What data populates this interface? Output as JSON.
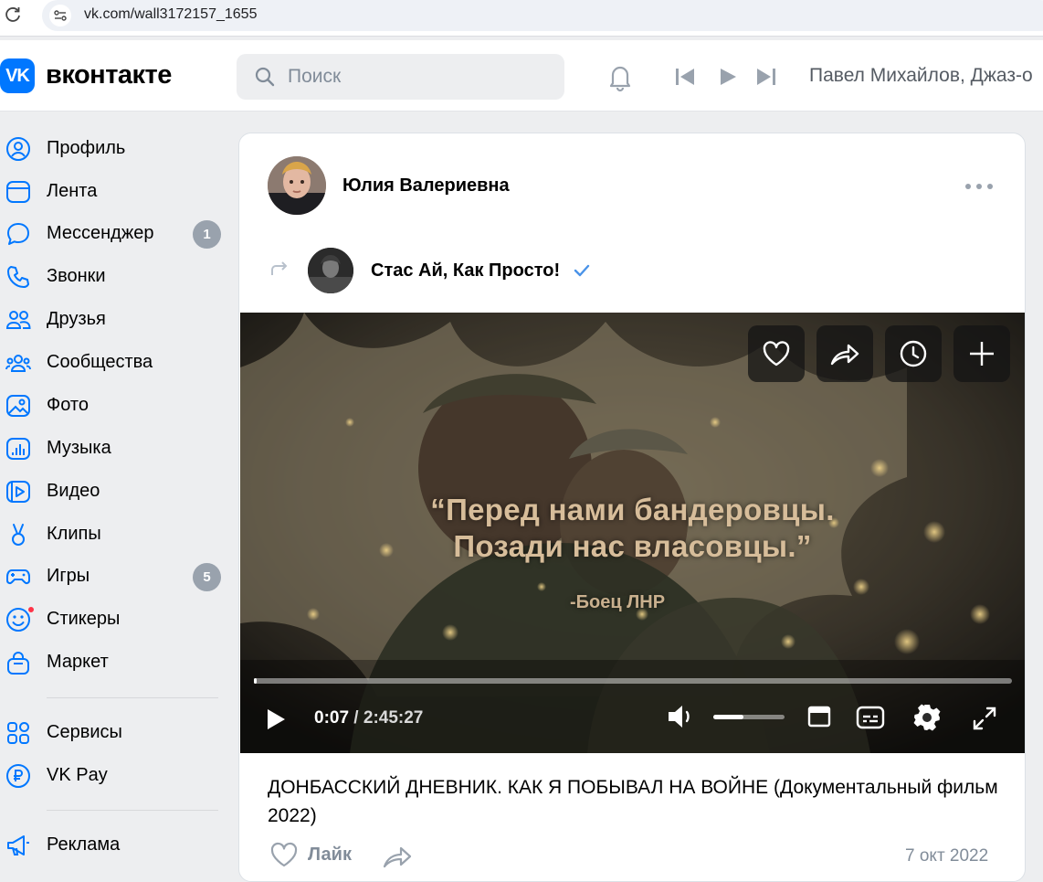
{
  "browser": {
    "url": "vk.com/wall3172157_1655"
  },
  "header": {
    "logo_icon_text": "VK",
    "logo_text": "вконтакте",
    "search_placeholder": "Поиск",
    "now_playing": "Павел Михайлов, Джаз-о"
  },
  "sidebar": {
    "items": [
      {
        "label": "Профиль",
        "icon": "profile-icon"
      },
      {
        "label": "Лента",
        "icon": "feed-icon"
      },
      {
        "label": "Мессенджер",
        "icon": "messenger-icon",
        "badge": "1"
      },
      {
        "label": "Звонки",
        "icon": "calls-icon"
      },
      {
        "label": "Друзья",
        "icon": "friends-icon"
      },
      {
        "label": "Сообщества",
        "icon": "communities-icon"
      },
      {
        "label": "Фото",
        "icon": "photo-icon"
      },
      {
        "label": "Музыка",
        "icon": "music-icon"
      },
      {
        "label": "Видео",
        "icon": "video-icon"
      },
      {
        "label": "Клипы",
        "icon": "clips-icon"
      },
      {
        "label": "Игры",
        "icon": "games-icon",
        "badge": "5"
      },
      {
        "label": "Стикеры",
        "icon": "stickers-icon"
      },
      {
        "label": "Маркет",
        "icon": "market-icon"
      },
      {
        "label": "Сервисы",
        "icon": "services-icon"
      },
      {
        "label": "VK Pay",
        "icon": "vkpay-icon"
      },
      {
        "label": "Реклама",
        "icon": "ads-icon"
      }
    ]
  },
  "post": {
    "author": "Юлия Валериевна",
    "repost_author": "Стас Ай, Как Просто!",
    "video": {
      "quote": "“Перед нами бандеровцы.\nПозади нас власовцы.”",
      "quote_author": "-Боец ЛНР",
      "current_time": "0:07",
      "separator": " / ",
      "total_time": "2:45:27",
      "progress": 0.001,
      "volume": 0.42
    },
    "title": "ДОНБАССКИЙ ДНЕВНИК. КАК Я ПОБЫВАЛ НА ВОЙНЕ (Документальный фильм 2022)",
    "like_label": "Лайк",
    "date": "7 окт 2022"
  },
  "colors": {
    "accent": "#0077ff",
    "badge": "#99a2ad",
    "secondary_text": "#818c99",
    "page_bg": "#edeef0"
  }
}
